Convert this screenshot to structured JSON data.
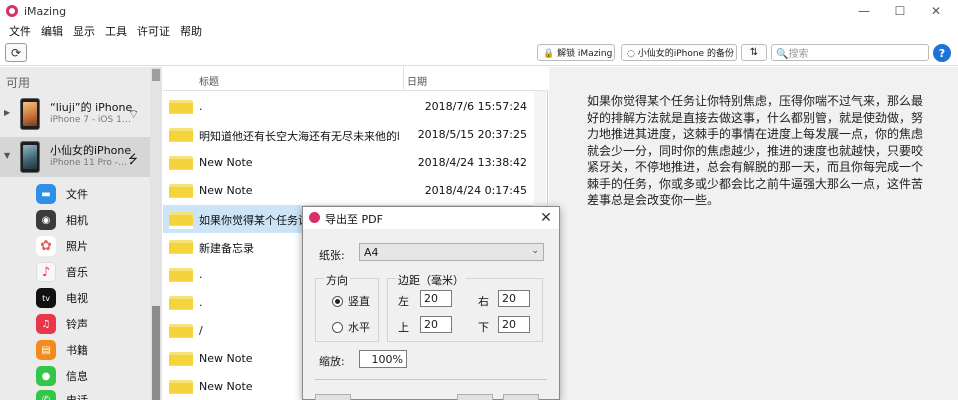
{
  "window": {
    "title": "iMazing",
    "minimize_glyph": "—",
    "maximize_glyph": "☐",
    "close_glyph": "✕"
  },
  "menu": [
    "文件",
    "编辑",
    "显示",
    "工具",
    "许可证",
    "帮助"
  ],
  "toolbar": {
    "refresh_icon": "⟳",
    "unlock_label": "🔒 解锁 iMazing",
    "backup_label": "◌ 小仙女的iPhone 的备份",
    "sort_label": "⇅",
    "search_placeholder": "🔍搜索",
    "help_label": "?"
  },
  "sidebar": {
    "header": "可用",
    "devices": [
      {
        "name": "“liuji”的 iPhone",
        "model": "iPhone 7 - iOS 1…",
        "status_icon": "wifi-icon",
        "status_glyph": "⌔",
        "arrow": "▶"
      },
      {
        "name": "小仙女的iPhone",
        "model": "iPhone 11 Pro -…",
        "status_icon": "usb-icon",
        "status_glyph": "⭍",
        "arrow": "▼"
      }
    ],
    "apps": [
      {
        "label": "文件",
        "icon": "folder-icon",
        "color": "#2f8fe6",
        "glyph": "▬"
      },
      {
        "label": "相机",
        "icon": "camera-icon",
        "color": "#3b3b3b",
        "glyph": "◉"
      },
      {
        "label": "照片",
        "icon": "photos-icon",
        "color": "#e85d5d",
        "glyph": "✿"
      },
      {
        "label": "音乐",
        "icon": "music-icon",
        "color": "#f7f7f7",
        "glyph": "♪"
      },
      {
        "label": "电视",
        "icon": "tv-icon",
        "color": "#111111",
        "glyph": "tv"
      },
      {
        "label": "铃声",
        "icon": "ringtone-icon",
        "color": "#e8364b",
        "glyph": "♫"
      },
      {
        "label": "书籍",
        "icon": "books-icon",
        "color": "#f28a1c",
        "glyph": "▤"
      },
      {
        "label": "信息",
        "icon": "messages-icon",
        "color": "#33c74a",
        "glyph": "●"
      },
      {
        "label": "电话",
        "icon": "phone-icon",
        "color": "#33c74a",
        "glyph": "✆"
      }
    ]
  },
  "notes": {
    "columns": {
      "title": "标题",
      "date": "日期"
    },
    "rows": [
      {
        "title": ".",
        "date": "2018/7/6 15:57:24"
      },
      {
        "title": "明知道他还有长空大海还有无尽未来他的时…",
        "date": "2018/5/15 20:37:25"
      },
      {
        "title": "New Note",
        "date": "2018/4/24 13:38:42"
      },
      {
        "title": "New Note",
        "date": "2018/4/24 0:17:45"
      },
      {
        "title": "如果你觉得某个任务让你",
        "date": ""
      },
      {
        "title": "新建备忘录",
        "date": ""
      },
      {
        "title": ".",
        "date": ""
      },
      {
        "title": ".",
        "date": ""
      },
      {
        "title": "/",
        "date": ""
      },
      {
        "title": "New Note",
        "date": ""
      },
      {
        "title": "New Note",
        "date": ""
      }
    ]
  },
  "preview": {
    "text": "如果你觉得某个任务让你特别焦虑，压得你喘不过气来，那么最好的排解方法就是直接去做这事，什么都别管，就是使劲做，努力地推进其进度，这棘手的事情在进度上每发展一点，你的焦虑就会少一分，同时你的焦虑越少，推进的速度也就越快，只要咬紧牙关，不停地推进，总会有解脱的那一天，而且你每完成一个棘手的任务，你或多或少都会比之前牛逼强大那么一点，这件苦差事总是会改变你一些。"
  },
  "dialog": {
    "title": "导出至 PDF",
    "close_glyph": "✕",
    "paper_label": "纸张:",
    "paper_value": "A4",
    "chevron": "⌄",
    "orientation": {
      "legend": "方向",
      "portrait": "竖直",
      "landscape": "水平",
      "selected": "portrait"
    },
    "margins": {
      "legend": "边距（毫米）",
      "left_label": "左",
      "left": "20",
      "right_label": "右",
      "right": "20",
      "top_label": "上",
      "top": "20",
      "bottom_label": "下",
      "bottom": "20"
    },
    "zoom_label": "缩放:",
    "zoom_value": "100%"
  }
}
